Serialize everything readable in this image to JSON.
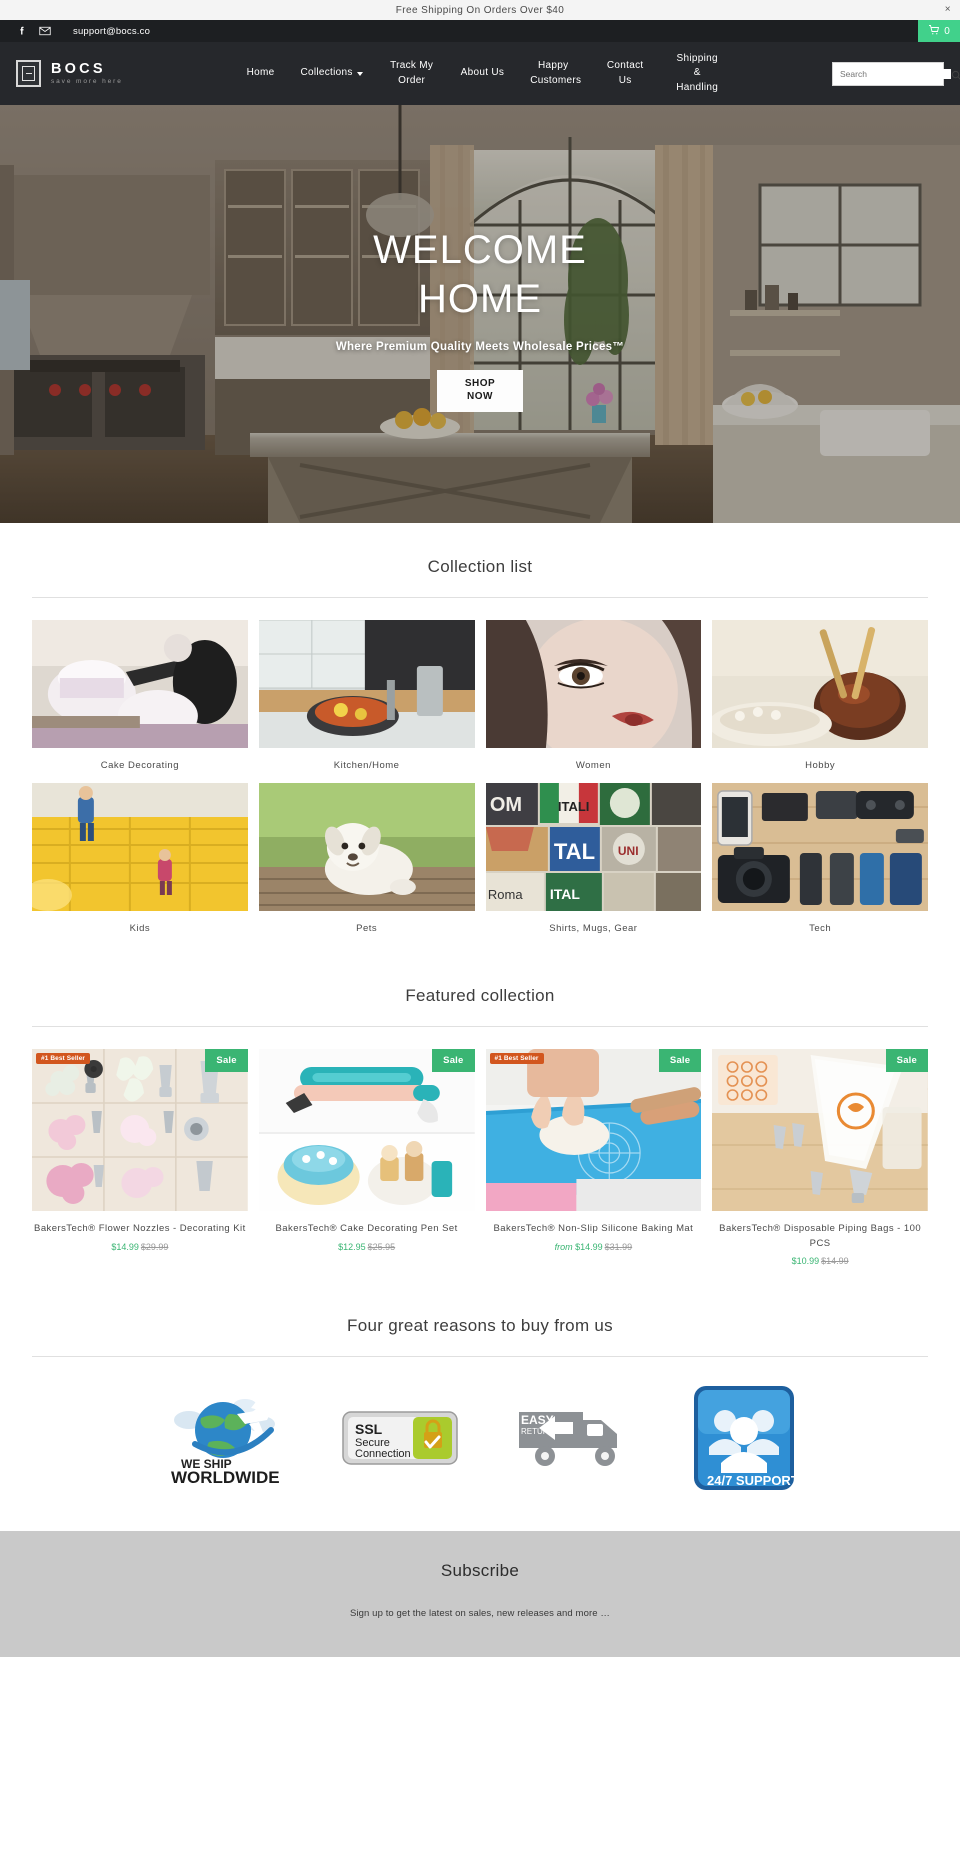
{
  "announcement": {
    "text": "Free Shipping On Orders Over $40",
    "close_label": "×"
  },
  "topbar": {
    "facebook_icon": "facebook-icon",
    "mail_icon": "mail-icon",
    "email": "support@bocs.co",
    "cart_icon": "cart-icon",
    "cart_count": "0",
    "cart_accent": "#41d18b"
  },
  "header": {
    "logo_icon": "bocs-logo-icon",
    "brand": "BOCS",
    "tagline": "save more here",
    "menu": [
      {
        "label": "Home",
        "has_dropdown": false
      },
      {
        "label": "Collections",
        "has_dropdown": true
      },
      {
        "label": "Track My Order",
        "has_dropdown": false
      },
      {
        "label": "About Us",
        "has_dropdown": false
      },
      {
        "label": "Happy Customers",
        "has_dropdown": false
      },
      {
        "label": "Contact Us",
        "has_dropdown": false
      },
      {
        "label": "Shipping & Handling",
        "has_dropdown": false
      }
    ],
    "search": {
      "placeholder": "Search",
      "value": "",
      "icon": "search-icon"
    }
  },
  "hero": {
    "title_line1": "WELCOME",
    "title_line2": "HOME",
    "subtitle": "Where Premium Quality Meets Wholesale Prices™",
    "cta_line1": "SHOP",
    "cta_line2": "NOW"
  },
  "collection_section": {
    "title": "Collection list",
    "items": [
      {
        "label": "Cake Decorating"
      },
      {
        "label": "Kitchen/Home"
      },
      {
        "label": "Women"
      },
      {
        "label": "Hobby"
      },
      {
        "label": "Kids"
      },
      {
        "label": "Pets"
      },
      {
        "label": "Shirts, Mugs, Gear"
      },
      {
        "label": "Tech"
      }
    ]
  },
  "featured_section": {
    "title": "Featured collection",
    "sale_badge": "Sale",
    "best_seller_badge": "#1 Best Seller",
    "products": [
      {
        "title": "BakersTech® Flower Nozzles - Decorating Kit",
        "price": "$14.99",
        "compare_price": "$29.99",
        "from_prefix": "",
        "best_seller": true,
        "on_sale": true
      },
      {
        "title": "BakersTech® Cake Decorating Pen Set",
        "price": "$12.95",
        "compare_price": "$25.95",
        "from_prefix": "",
        "best_seller": false,
        "on_sale": true
      },
      {
        "title": "BakersTech® Non-Slip Silicone Baking Mat",
        "price": "$14.99",
        "compare_price": "$31.99",
        "from_prefix": "from",
        "best_seller": true,
        "on_sale": true
      },
      {
        "title": "BakersTech® Disposable Piping Bags - 100 PCS",
        "price": "$10.99",
        "compare_price": "$14.99",
        "from_prefix": "",
        "best_seller": false,
        "on_sale": true
      }
    ]
  },
  "reasons_section": {
    "title": "Four great reasons to buy from us",
    "badges": [
      {
        "icon": "globe-airplane-icon",
        "line1": "WE SHIP",
        "line2": "WORLDWIDE"
      },
      {
        "icon": "ssl-lock-icon",
        "line1": "SSL",
        "line2": "Secure",
        "line3": "Connection"
      },
      {
        "icon": "easy-returns-truck-icon",
        "line1": "EASY",
        "line2": "RETURNS"
      },
      {
        "icon": "support-people-icon",
        "line1": "24/7 SUPPORT"
      }
    ]
  },
  "subscribe": {
    "title": "Subscribe",
    "text": "Sign up to get the latest on sales, new releases and more …"
  }
}
